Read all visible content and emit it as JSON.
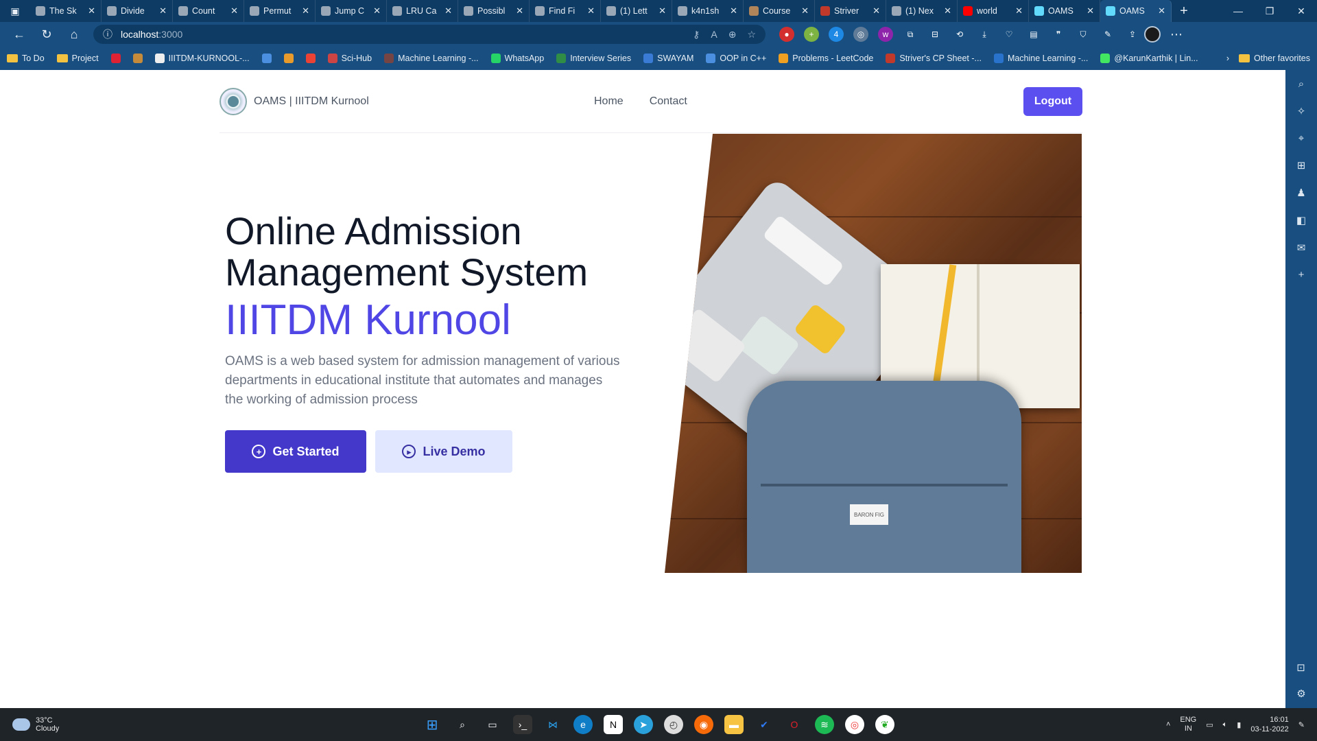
{
  "browser": {
    "tabs": [
      {
        "title": "The Sk",
        "favicon_color": "#9aa7b6"
      },
      {
        "title": "Divide",
        "favicon_color": "#9aa7b6"
      },
      {
        "title": "Count",
        "favicon_color": "#9aa7b6"
      },
      {
        "title": "Permut",
        "favicon_color": "#9aa7b6"
      },
      {
        "title": "Jump C",
        "favicon_color": "#9aa7b6"
      },
      {
        "title": "LRU Ca",
        "favicon_color": "#9aa7b6"
      },
      {
        "title": "Possibl",
        "favicon_color": "#9aa7b6"
      },
      {
        "title": "Find Fi",
        "favicon_color": "#9aa7b6"
      },
      {
        "title": "(1) Lett",
        "favicon_color": "#9aa7b6"
      },
      {
        "title": "k4n1sh",
        "favicon_color": "#9aa7b6"
      },
      {
        "title": "Course",
        "favicon_color": "#b0855a"
      },
      {
        "title": "Striver",
        "favicon_color": "#c0392b"
      },
      {
        "title": "(1) Nex",
        "favicon_color": "#9aa7b6"
      },
      {
        "title": "world",
        "favicon_color": "#ff0000"
      },
      {
        "title": "OAMS",
        "favicon_color": "#61dafb"
      },
      {
        "title": "OAMS",
        "favicon_color": "#61dafb",
        "active": true
      }
    ],
    "url_host": "localhost",
    "url_port": ":3000",
    "bookmarks": [
      {
        "label": "To Do",
        "icon": "folder-icon"
      },
      {
        "label": "Project",
        "icon": "folder-icon"
      },
      {
        "label": "",
        "icon": "badge-258-icon"
      },
      {
        "label": "",
        "icon": "in-icon"
      },
      {
        "label": "IIITDM-KURNOOL-...",
        "icon": "page-icon"
      },
      {
        "label": "",
        "icon": "chart-icon"
      },
      {
        "label": "",
        "icon": "gear-icon"
      },
      {
        "label": "",
        "icon": "gmail-icon"
      },
      {
        "label": "Sci-Hub",
        "icon": "scihub-icon"
      },
      {
        "label": "Machine Learning -...",
        "icon": "ml-icon"
      },
      {
        "label": "WhatsApp",
        "icon": "whatsapp-icon"
      },
      {
        "label": "Interview Series",
        "icon": "gfg-icon"
      },
      {
        "label": "SWAYAM",
        "icon": "swayam-icon"
      },
      {
        "label": "OOP in C++",
        "icon": "chart-icon"
      },
      {
        "label": "Problems - LeetCode",
        "icon": "leetcode-icon"
      },
      {
        "label": "Striver's CP Sheet -...",
        "icon": "striver-icon"
      },
      {
        "label": "Machine Learning -...",
        "icon": "coursera-icon"
      },
      {
        "label": "@KarunKarthik | Lin...",
        "icon": "linktree-icon"
      }
    ],
    "other_favorites": "Other favorites"
  },
  "site": {
    "brand": "OAMS | IIITDM Kurnool",
    "nav": {
      "home": "Home",
      "contact": "Contact"
    },
    "logout": "Logout",
    "hero": {
      "title_line1": "Online Admission",
      "title_line2": "Management System",
      "accent": "IIITDM Kurnool",
      "description": "OAMS is a web based system for admission management of various departments in educational institute that automates and manages the working of admission process",
      "get_started": "Get Started",
      "live_demo": "Live Demo"
    },
    "image_bag_label": "BARON FIG",
    "colors": {
      "accent": "#4f46e5",
      "primary_button": "#4338ca",
      "secondary_button": "#e0e7ff",
      "logout": "#5b4ff0"
    }
  },
  "taskbar": {
    "weather_temp": "33°C",
    "weather_desc": "Cloudy",
    "lang_line1": "ENG",
    "lang_line2": "IN",
    "time": "16:01",
    "date": "03-11-2022"
  }
}
